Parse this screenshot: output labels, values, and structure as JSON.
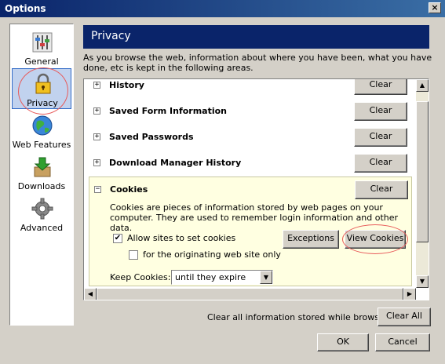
{
  "window": {
    "title": "Options",
    "close_icon": "close-icon"
  },
  "sidebar": {
    "items": [
      {
        "label": "General",
        "icon": "switches-icon"
      },
      {
        "label": "Privacy",
        "icon": "padlock-icon",
        "selected": true
      },
      {
        "label": "Web Features",
        "icon": "globe-icon"
      },
      {
        "label": "Downloads",
        "icon": "download-box-icon"
      },
      {
        "label": "Advanced",
        "icon": "gear-icon"
      }
    ]
  },
  "header": {
    "title": "Privacy"
  },
  "description": "As you browse the web, information about where you have been, what you have done, etc is kept in the following areas.",
  "items": [
    {
      "title": "History",
      "expand": "+",
      "clear_label": "Clear"
    },
    {
      "title": "Saved Form Information",
      "expand": "+",
      "clear_label": "Clear"
    },
    {
      "title": "Saved Passwords",
      "expand": "+",
      "clear_label": "Clear"
    },
    {
      "title": "Download Manager History",
      "expand": "+",
      "clear_label": "Clear"
    }
  ],
  "cookies": {
    "title": "Cookies",
    "expand": "−",
    "clear_label": "Clear",
    "description": "Cookies are pieces of information stored by web pages on your computer. They are used to remember login information and other data.",
    "allow_label": "Allow sites to set cookies",
    "allow_checked": true,
    "originating_label": "for the originating web site only",
    "originating_checked": false,
    "exceptions_label": "Exceptions",
    "view_cookies_label": "View Cookies",
    "keep_label": "Keep Cookies:",
    "keep_value": "until they expire"
  },
  "footer": {
    "clear_all_text": "Clear all information stored while browsing:",
    "clear_all_label": "Clear All",
    "ok_label": "OK",
    "cancel_label": "Cancel"
  },
  "colors": {
    "header_bg": "#0a246a",
    "annotation": "#e85a5a",
    "cookies_bg": "#ffffe1"
  }
}
